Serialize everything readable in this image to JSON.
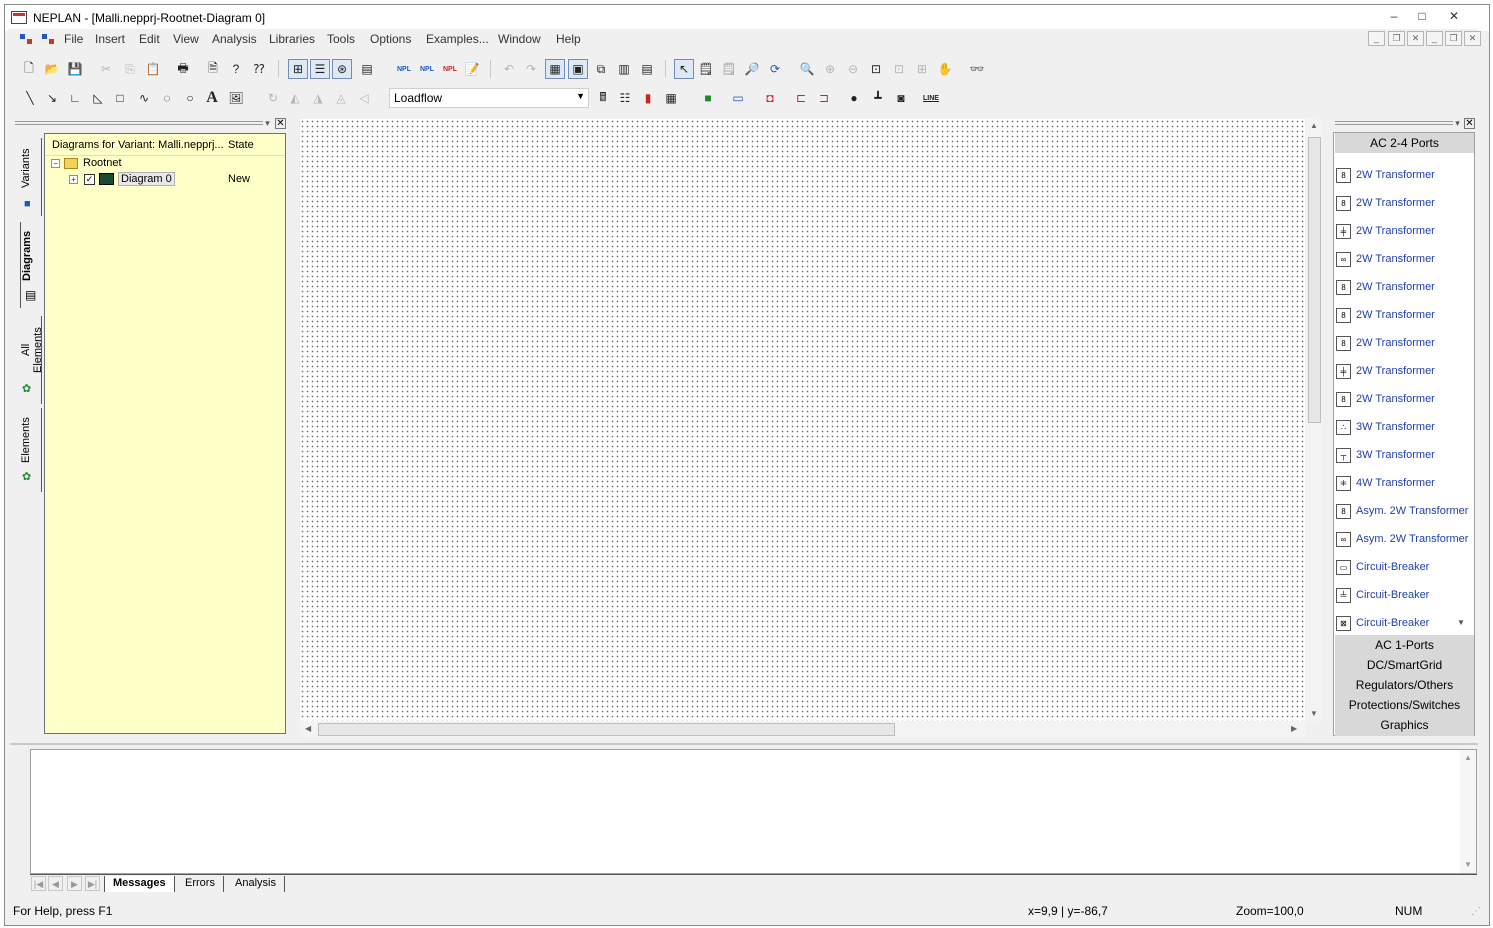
{
  "window": {
    "title": "NEPLAN - [Malli.nepprj-Rootnet-Diagram 0]",
    "minimize": "–",
    "maximize": "□",
    "close": "✕"
  },
  "menu": {
    "items": [
      "File",
      "Insert",
      "Edit",
      "View",
      "Analysis",
      "Libraries",
      "Tools",
      "Options",
      "Examples...",
      "Window",
      "Help"
    ]
  },
  "toolbar": {
    "npl_labels": [
      "NPL",
      "NPL",
      "NPL"
    ],
    "calc_mode": "Loadflow",
    "line_label": "LINE",
    "text_tool": "A"
  },
  "left_panel": {
    "tabs": [
      "Variants",
      "Diagrams",
      "All Elements",
      "Elements"
    ],
    "active_tab": "Diagrams",
    "header_col1": "Diagrams for Variant: Malli.nepprj...",
    "header_col2": "State",
    "tree": [
      {
        "label": "Rootnet",
        "state": ""
      },
      {
        "label": "Diagram 0",
        "state": "New"
      }
    ]
  },
  "palette": {
    "group_top": "AC 2-4 Ports",
    "items": [
      {
        "label": "2W Transformer",
        "icon": "transformer-2w-icon"
      },
      {
        "label": "2W Transformer",
        "icon": "transformer-2w-icon"
      },
      {
        "label": "2W Transformer",
        "icon": "transformer-2w-icon"
      },
      {
        "label": "2W Transformer",
        "icon": "transformer-2w-icon"
      },
      {
        "label": "2W Transformer",
        "icon": "transformer-2w-icon"
      },
      {
        "label": "2W Transformer",
        "icon": "transformer-2w-icon"
      },
      {
        "label": "2W Transformer",
        "icon": "transformer-2w-icon"
      },
      {
        "label": "2W Transformer",
        "icon": "transformer-2w-icon"
      },
      {
        "label": "2W Transformer",
        "icon": "transformer-2w-icon"
      },
      {
        "label": "3W Transformer",
        "icon": "transformer-3w-icon"
      },
      {
        "label": "3W Transformer",
        "icon": "transformer-3w-icon"
      },
      {
        "label": "4W Transformer",
        "icon": "transformer-4w-icon"
      },
      {
        "label": "Asym. 2W Transformer",
        "icon": "transformer-asym-icon"
      },
      {
        "label": "Asym. 2W Transformer",
        "icon": "transformer-asym-icon"
      },
      {
        "label": "Circuit-Breaker",
        "icon": "breaker-icon"
      },
      {
        "label": "Circuit-Breaker",
        "icon": "breaker-icon"
      },
      {
        "label": "Circuit-Breaker",
        "icon": "breaker-icon"
      }
    ],
    "groups_bottom": [
      "AC 1-Ports",
      "DC/SmartGrid",
      "Regulators/Others",
      "Protections/Switches",
      "Graphics"
    ]
  },
  "bottom_panel": {
    "tabs": [
      "Messages",
      "Errors",
      "Analysis"
    ],
    "active_tab": "Messages"
  },
  "status": {
    "help": "For Help, press F1",
    "coords": "x=9,9 | y=-86,7",
    "zoom": "Zoom=100,0",
    "num": "NUM"
  },
  "colors": {
    "tree_background": "#ffffc8",
    "palette_link": "#1f3fb0"
  }
}
